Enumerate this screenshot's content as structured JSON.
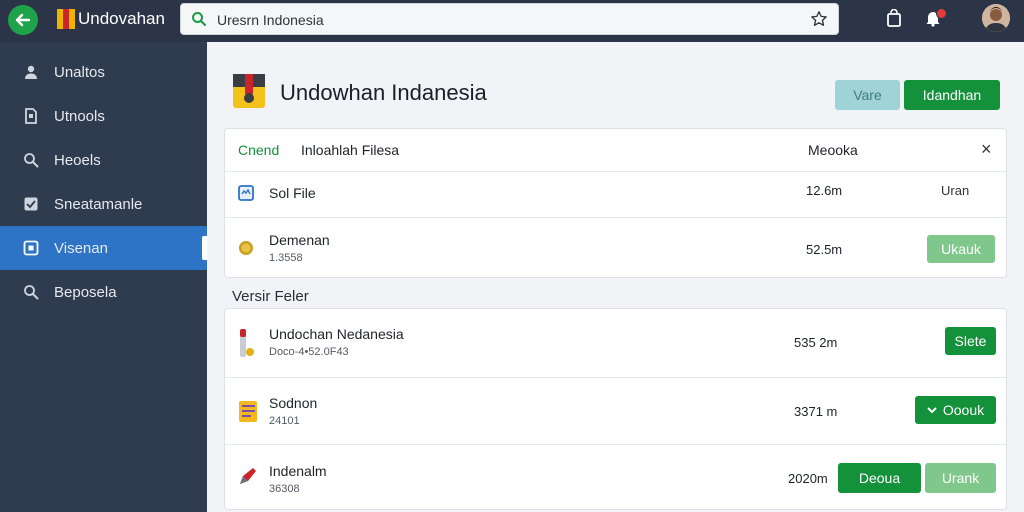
{
  "topbar": {
    "app_title": "Undovahan",
    "search_value": "Uresrn Indonesia",
    "colors": {
      "bar": "#2b3547",
      "back": "#1fa34a"
    }
  },
  "sidebar": {
    "items": [
      {
        "label": "Unaltos",
        "icon": "user-icon"
      },
      {
        "label": "Utnools",
        "icon": "document-icon"
      },
      {
        "label": "Heoels",
        "icon": "search-icon"
      },
      {
        "label": "Sneatamanle",
        "icon": "checkbox-icon"
      },
      {
        "label": "Visenan",
        "icon": "square-icon",
        "active": true
      },
      {
        "label": "Beposela",
        "icon": "search-icon"
      }
    ]
  },
  "main": {
    "title": "Undowhan Indanesia",
    "header_buttons": {
      "secondary": "Vare",
      "primary": "Idandhan"
    },
    "file_panel": {
      "tab_active": "Cnend",
      "tab_label": "Inloahlah Filesa",
      "col_header": "Meooka",
      "close_symbol": "×",
      "rows": [
        {
          "name": "Sol File",
          "sub": "",
          "size": "12.6m",
          "action": "Uran",
          "icon": "file-icon"
        },
        {
          "name": "Demenan",
          "sub": "1.3558",
          "size": "52.5m",
          "action": "Ukauk",
          "icon": "coin-icon"
        }
      ]
    },
    "section_label": "Versir Feler",
    "versions": [
      {
        "name": "Undochan Nedanesia",
        "sub": "Doco-4•52.0F43",
        "size": "535 2m",
        "actions": [
          "Slete"
        ],
        "icon": "tube-icon"
      },
      {
        "name": "Sodnon",
        "sub": "24101",
        "size": "3371 m",
        "actions": [
          "Ooouk"
        ],
        "icon": "folder-icon"
      },
      {
        "name": "Indenalm",
        "sub": "36308",
        "size": "2020m",
        "actions": [
          "Deoua",
          "Urank"
        ],
        "icon": "pencil-icon"
      }
    ]
  },
  "colors": {
    "accent": "#2d73c6",
    "green": "#13913b",
    "sidebar": "#2f3b4f"
  }
}
